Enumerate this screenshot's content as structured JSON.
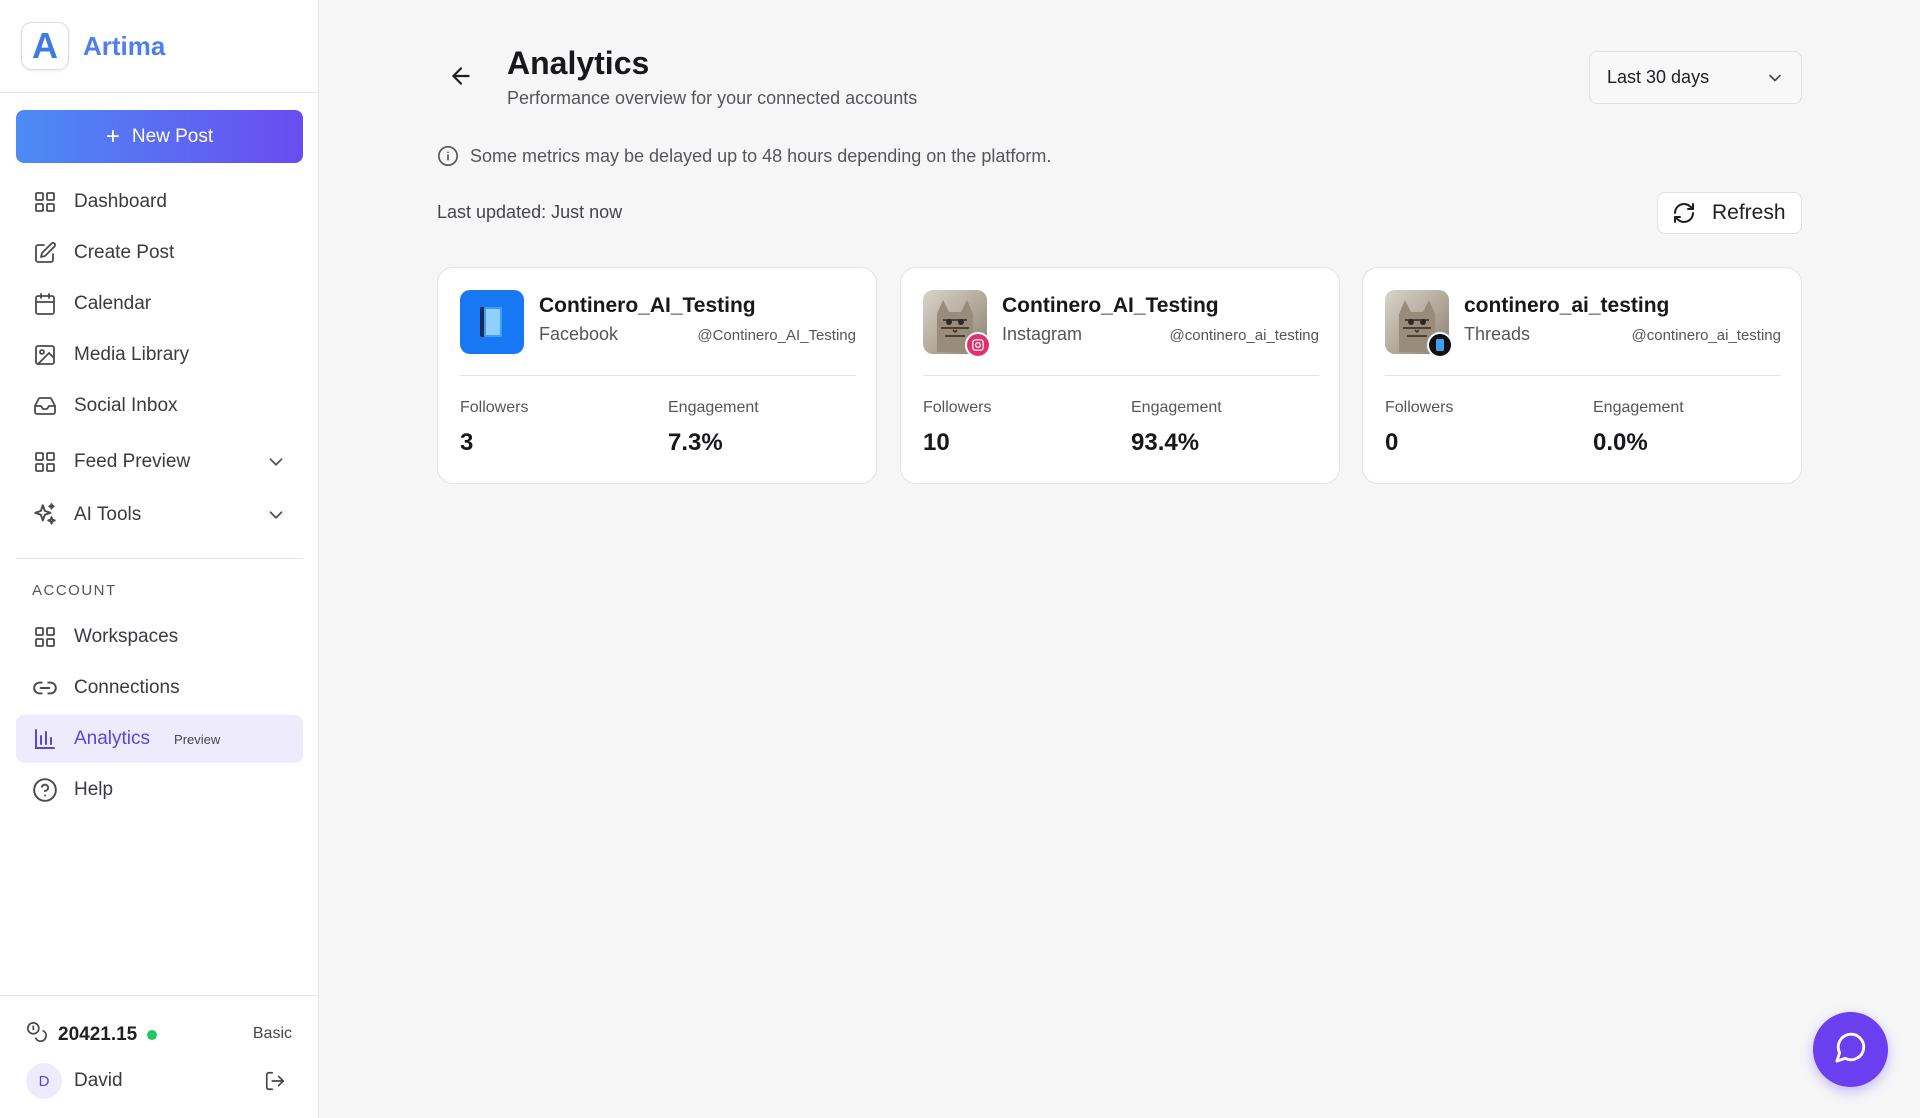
{
  "brand": {
    "name": "Artima",
    "logo_letter": "A"
  },
  "sidebar": {
    "new_post_label": "New Post",
    "nav_items": [
      {
        "label": "Dashboard",
        "icon": "grid-icon"
      },
      {
        "label": "Create Post",
        "icon": "edit-icon"
      },
      {
        "label": "Calendar",
        "icon": "calendar-icon"
      },
      {
        "label": "Media Library",
        "icon": "image-icon"
      },
      {
        "label": "Social Inbox",
        "icon": "inbox-icon"
      },
      {
        "label": "Feed Preview",
        "icon": "grid-icon",
        "expandable": true
      },
      {
        "label": "AI Tools",
        "icon": "sparkles-icon",
        "expandable": true
      }
    ],
    "account_section_label": "ACCOUNT",
    "account_items": [
      {
        "label": "Workspaces",
        "icon": "grid-icon"
      },
      {
        "label": "Connections",
        "icon": "link-icon"
      },
      {
        "label": "Analytics",
        "icon": "bar-chart-icon",
        "badge": "Preview",
        "active": true
      },
      {
        "label": "Help",
        "icon": "help-circle-icon"
      }
    ],
    "footer": {
      "credits": "20421.15",
      "plan": "Basic",
      "user_initial": "D",
      "user_name": "David"
    }
  },
  "header": {
    "title": "Analytics",
    "subtitle": "Performance overview for your connected accounts",
    "date_range": "Last 30 days"
  },
  "notice": "Some metrics may be delayed up to 48 hours depending on the platform.",
  "last_updated": "Last updated: Just now",
  "refresh_label": "Refresh",
  "metric_labels": {
    "followers": "Followers",
    "engagement": "Engagement"
  },
  "accounts": [
    {
      "name": "Continero_AI_Testing",
      "platform": "Facebook",
      "handle": "@Continero_AI_Testing",
      "followers": "3",
      "engagement": "7.3%",
      "avatar": "facebook-page-icon"
    },
    {
      "name": "Continero_AI_Testing",
      "platform": "Instagram",
      "handle": "@continero_ai_testing",
      "followers": "10",
      "engagement": "93.4%",
      "avatar": "cat-photo",
      "badge": "instagram-icon",
      "badge_color": "#e1306c"
    },
    {
      "name": "continero_ai_testing",
      "platform": "Threads",
      "handle": "@continero_ai_testing",
      "followers": "0",
      "engagement": "0.0%",
      "avatar": "cat-photo",
      "badge": "threads-icon",
      "badge_color": "#111111"
    }
  ],
  "colors": {
    "accent": "#5b45e0",
    "gradient_start": "#4b8cf5",
    "gradient_end": "#6a4cf0",
    "online": "#22c55e",
    "chat_fab": "#6a3ff0"
  }
}
